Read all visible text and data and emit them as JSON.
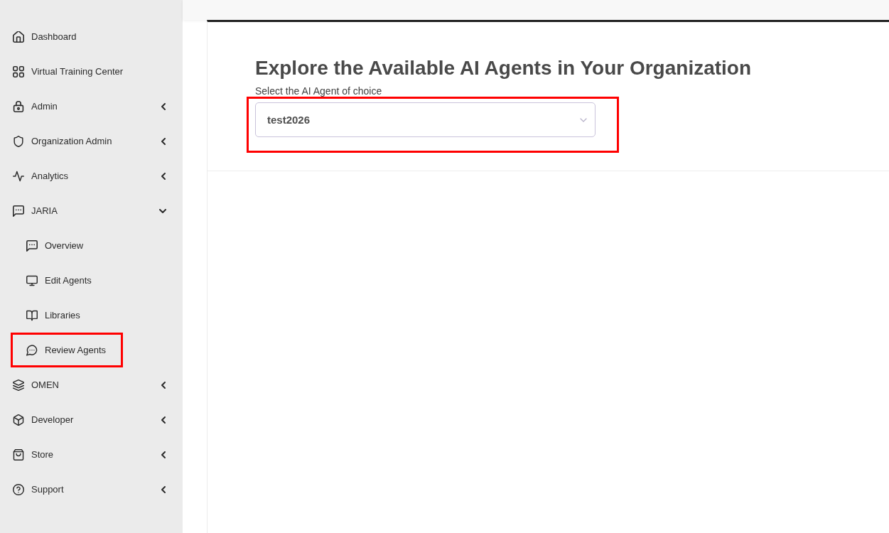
{
  "sidebar": {
    "items": [
      {
        "label": "Dashboard",
        "kind": "link",
        "highlighted": false
      },
      {
        "label": "Virtual Training Center",
        "kind": "link",
        "highlighted": false
      },
      {
        "label": "Admin",
        "kind": "group",
        "expanded": false,
        "highlighted": false
      },
      {
        "label": "Organization Admin",
        "kind": "group",
        "expanded": false,
        "highlighted": false
      },
      {
        "label": "Analytics",
        "kind": "group",
        "expanded": false,
        "highlighted": false
      },
      {
        "label": "JARIA",
        "kind": "group",
        "expanded": true,
        "highlighted": false,
        "children": [
          {
            "label": "Overview",
            "highlighted": false
          },
          {
            "label": "Edit Agents",
            "highlighted": false
          },
          {
            "label": "Libraries",
            "highlighted": false
          },
          {
            "label": "Review Agents",
            "highlighted": true
          }
        ]
      },
      {
        "label": "OMEN",
        "kind": "group",
        "expanded": false,
        "highlighted": false
      },
      {
        "label": "Developer",
        "kind": "group",
        "expanded": false,
        "highlighted": false
      },
      {
        "label": "Store",
        "kind": "group",
        "expanded": false,
        "highlighted": false
      },
      {
        "label": "Support",
        "kind": "group",
        "expanded": false,
        "highlighted": false
      }
    ]
  },
  "main": {
    "heading": "Explore the Available AI Agents in Your Organization",
    "agent_select": {
      "label": "Select the AI Agent of choice",
      "value": "test2026",
      "highlighted": true
    }
  }
}
